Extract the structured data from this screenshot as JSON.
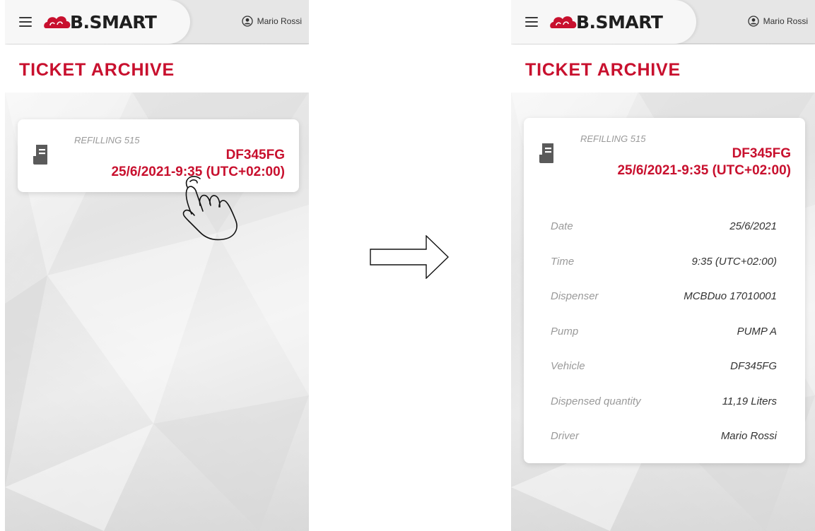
{
  "app": {
    "logo_text": "B.SMART",
    "user_name": "Mario Rossi"
  },
  "page": {
    "title": "TICKET ARCHIVE"
  },
  "ticket": {
    "type_label": "REFILLING 515",
    "plate": "DF345FG",
    "datetime": "25/6/2021-9:35 (UTC+02:00)"
  },
  "details": [
    {
      "label": "Date",
      "value": "25/6/2021"
    },
    {
      "label": "Time",
      "value": "9:35 (UTC+02:00)"
    },
    {
      "label": "Dispenser",
      "value": "MCBDuo 17010001"
    },
    {
      "label": "Pump",
      "value": "PUMP A"
    },
    {
      "label": "Vehicle",
      "value": "DF345FG"
    },
    {
      "label": "Dispensed quantity",
      "value": "11,19 Liters"
    },
    {
      "label": "Driver",
      "value": "Mario Rossi"
    }
  ],
  "colors": {
    "accent": "#c8102e",
    "topbar": "#e6e6e6",
    "card": "#ffffff"
  },
  "icons": {
    "menu": "hamburger-menu-icon",
    "user": "user-circle-icon",
    "ticket": "receipt-icon",
    "gesture": "tap-hand-icon",
    "transition": "right-arrow-icon"
  }
}
